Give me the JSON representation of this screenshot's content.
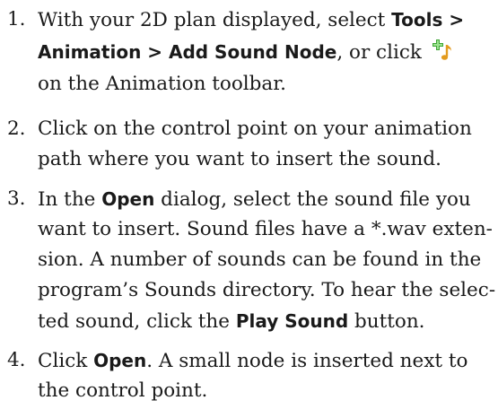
{
  "steps": [
    {
      "number": "1.",
      "l1a": "With your 2D plan displayed, select ",
      "l1b": "Tools >",
      "l2a": "Animation > Add Sound Node",
      "l2b": ", or click ",
      "l3": "on the Animation toolbar.",
      "icon": "add-sound-node-icon"
    },
    {
      "number": "2.",
      "l1": "Click on the control point on your animation",
      "l2": "path where you want to insert the sound."
    },
    {
      "number": "3.",
      "l1a": "In the ",
      "l1b": "Open",
      "l1c": " dialog, select the sound file you",
      "l2": "want to insert. Sound files have a *.wav exten-",
      "l3": "sion. A number of sounds can be found in the",
      "l4": "program’s Sounds directory. To hear the selec-",
      "l5a": "ted sound, click the ",
      "l5b": "Play Sound",
      "l5c": " button."
    },
    {
      "number": "4.",
      "l1a": "Click ",
      "l1b": "Open",
      "l1c": ". A small node is inserted next to",
      "l2": "the control point."
    }
  ],
  "colors": {
    "icon_plus": "#3fa535",
    "icon_note": "#e39b1f",
    "text": "#1a1a1a"
  }
}
